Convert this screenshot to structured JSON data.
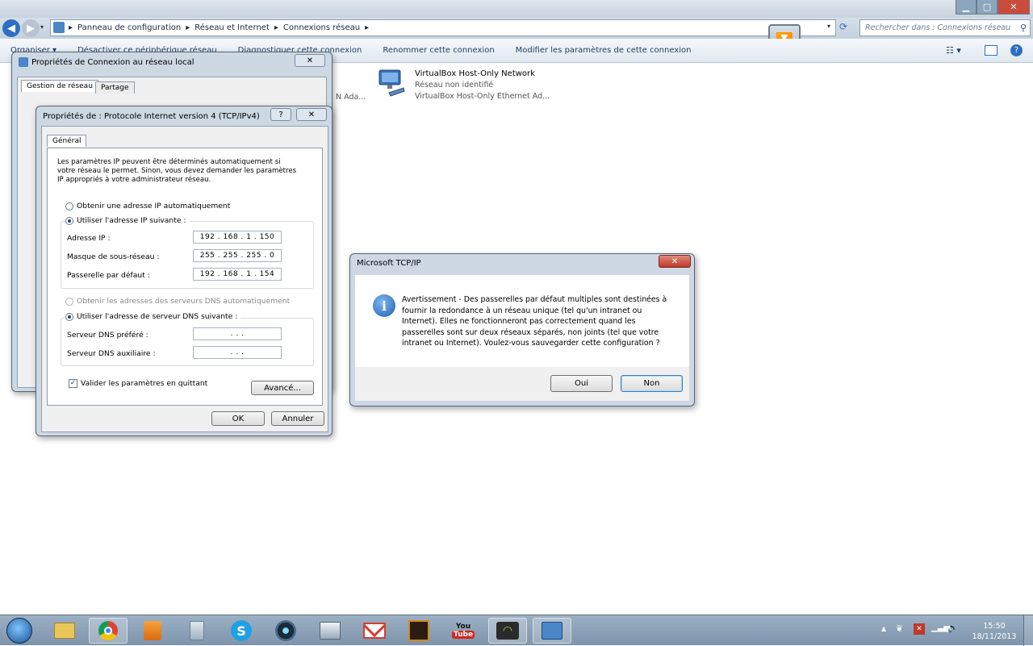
{
  "window_controls": {
    "minimize": "▁",
    "maximize": "▢",
    "close": "✕"
  },
  "breadcrumb": [
    "Panneau de configuration",
    "Réseau et Internet",
    "Connexions réseau"
  ],
  "search": {
    "placeholder": "Rechercher dans : Connexions réseau"
  },
  "toolbar": {
    "items": [
      "Organiser ▾",
      "Désactiver ce périphérique réseau",
      "Diagnostiquer cette connexion",
      "Renommer cette connexion",
      "Modifier les paramètres de cette connexion"
    ]
  },
  "network": {
    "name": "VirtualBox Host-Only Network",
    "status": "Réseau non identifié",
    "adapter": "VirtualBox Host-Only Ethernet Ad...",
    "partial_left": "N Ada..."
  },
  "lan_props": {
    "title": "Propriétés de Connexion au réseau local",
    "tabs": [
      "Gestion de réseau",
      "Partage"
    ]
  },
  "tcp_props": {
    "title": "Propriétés de : Protocole Internet version 4 (TCP/IPv4)",
    "help": "?",
    "tab": "Général",
    "intro": "Les paramètres IP peuvent être déterminés automatiquement si votre réseau le permet. Sinon, vous devez demander les paramètres IP appropriés à votre administrateur réseau.",
    "auto_ip": "Obtenir une adresse IP automatiquement",
    "manual_ip": "Utiliser l'adresse IP suivante :",
    "ip_label": "Adresse IP :",
    "ip_value": "192 . 168 . 1 . 150",
    "mask_label": "Masque de sous-réseau :",
    "mask_value": "255 . 255 . 255 . 0",
    "gw_label": "Passerelle par défaut :",
    "gw_value": "192 . 168 . 1 . 154",
    "auto_dns": "Obtenir les adresses des serveurs DNS automatiquement",
    "manual_dns": "Utiliser l'adresse de serveur DNS suivante :",
    "dns1_label": "Serveur DNS préféré :",
    "dns1_value": ". . .",
    "dns2_label": "Serveur DNS auxiliaire :",
    "dns2_value": ". . .",
    "validate": "Valider les paramètres en quittant",
    "advanced": "Avancé...",
    "ok": "OK",
    "cancel": "Annuler"
  },
  "alert": {
    "title": "Microsoft TCP/IP",
    "message": "Avertissement - Des passerelles par défaut multiples sont destinées à fournir la redondance à un réseau unique (tel qu'un intranet ou Internet). Elles ne fonctionneront pas correctement quand les passerelles sont sur deux réseaux séparés, non joints (tel que votre intranet ou Internet). Voulez-vous sauvegarder cette configuration ?",
    "yes": "Oui",
    "no": "Non"
  },
  "taskbar": {
    "icons": [
      "start-orb",
      "explorer",
      "chrome",
      "app-orange",
      "recycle-bin",
      "skype",
      "webcam",
      "fax",
      "gmail",
      "forums",
      "youtube",
      "wifi",
      "control-panel"
    ],
    "youtube_label": "You Tube",
    "clock_time": "15:50",
    "clock_date": "18/11/2013"
  },
  "colors": {
    "accent": "#1e3d5f",
    "title_bg": "#cdd8e3",
    "close_red": "#c0392b"
  }
}
